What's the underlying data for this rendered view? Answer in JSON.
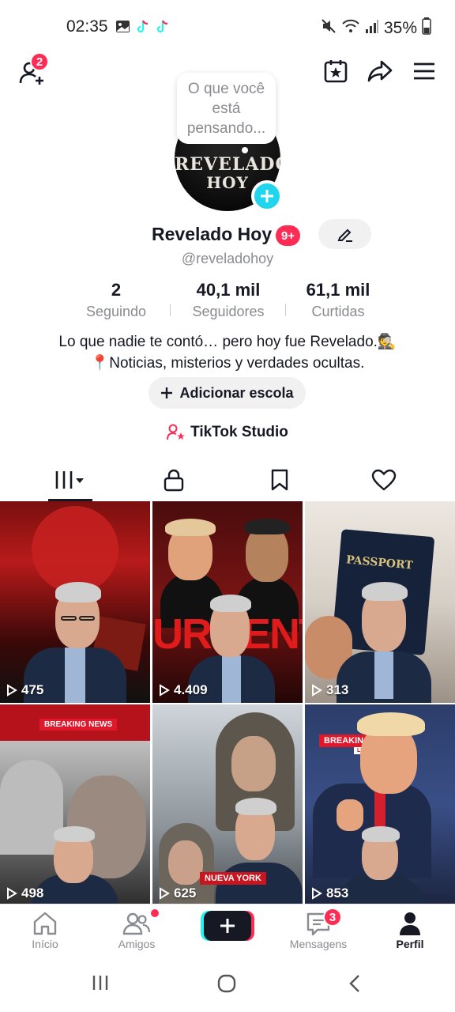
{
  "status_bar": {
    "time": "02:35",
    "battery": "35%",
    "icons": [
      "gallery-icon",
      "tiktok-icon",
      "tiktok-icon",
      "mute-icon",
      "wifi-icon",
      "signal-icon",
      "battery-icon"
    ]
  },
  "topbar": {
    "add_friends_badge": "2",
    "icons": [
      "add-friend-icon",
      "calendar-star-icon",
      "share-icon",
      "menu-icon"
    ]
  },
  "profile": {
    "thought_bubble": "O que você está pensando...",
    "avatar_line1": "REVELADO",
    "avatar_line2": "HOY",
    "name": "Revelado Hoy",
    "name_badge": "9+",
    "handle": "@reveladohoy"
  },
  "stats": [
    {
      "value": "2",
      "label": "Seguindo"
    },
    {
      "value": "40,1 mil",
      "label": "Seguidores"
    },
    {
      "value": "61,1 mil",
      "label": "Curtidas"
    }
  ],
  "bio": {
    "line1": "Lo que nadie te contó… pero hoy fue Revelado.🕵️",
    "line2": "📍Noticias, misterios y verdades ocultas."
  },
  "actions": {
    "add_school": "Adicionar escola",
    "studio": "TikTok Studio"
  },
  "tabs": [
    "videos-tab",
    "private-tab",
    "saved-tab",
    "liked-tab"
  ],
  "videos": [
    {
      "views": "475"
    },
    {
      "views": "4.409",
      "overlay": "URGENT"
    },
    {
      "views": "313",
      "overlay": "PASSPORT"
    },
    {
      "views": "498",
      "overlay": "BREAKING NEWS"
    },
    {
      "views": "625",
      "overlay": "NUEVA YORK"
    },
    {
      "views": "853",
      "overlay": "BREAKING",
      "overlay_small": "LIVE"
    }
  ],
  "bottom_nav": {
    "home": "Início",
    "friends": "Amigos",
    "messages": "Mensagens",
    "messages_badge": "3",
    "profile": "Perfil"
  },
  "colors": {
    "accent": "#fe2c55",
    "cyan": "#20d5ec",
    "text": "#161823",
    "muted": "#8a8b91"
  }
}
